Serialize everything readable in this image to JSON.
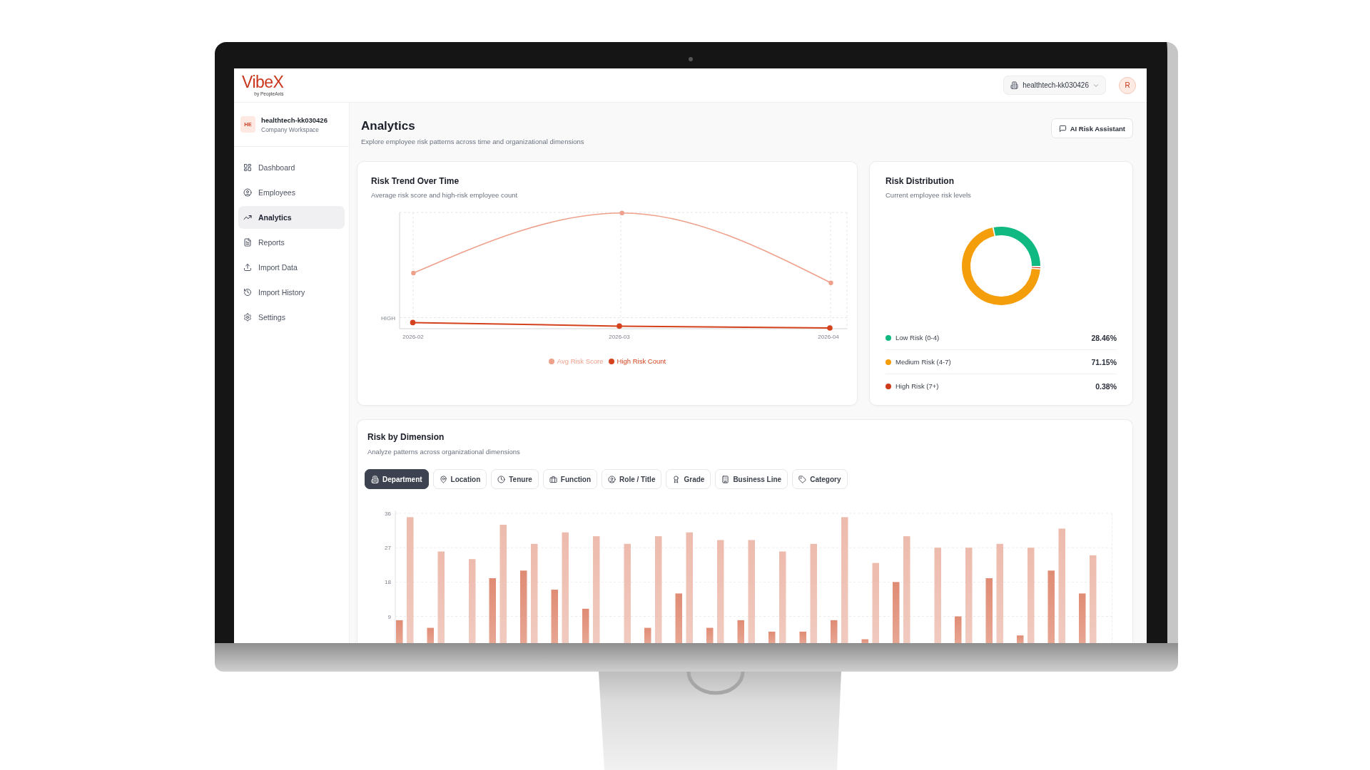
{
  "header": {
    "logo": "VibeX",
    "logo_tagline": "by PeopleAxis",
    "workspace_selector": "healthtech-kk030426",
    "avatar": "R"
  },
  "sidebar": {
    "workspace": {
      "initials": "HE",
      "name": "healthtech-kk030426",
      "label": "Company Workspace"
    },
    "items": [
      {
        "label": "Dashboard",
        "selected": false
      },
      {
        "label": "Employees",
        "selected": false
      },
      {
        "label": "Analytics",
        "selected": true
      },
      {
        "label": "Reports",
        "selected": false
      },
      {
        "label": "Import Data",
        "selected": false
      },
      {
        "label": "Import History",
        "selected": false
      },
      {
        "label": "Settings",
        "selected": false
      }
    ]
  },
  "page": {
    "title": "Analytics",
    "subtitle": "Explore employee risk patterns across time and organizational dimensions",
    "assistant_button": "AI Risk Assistant"
  },
  "risk_trend": {
    "title": "Risk Trend Over Time",
    "subtitle": "Average risk score and high-risk employee count",
    "y_axis_label": "HIGH",
    "x_labels": [
      "2026-02",
      "2026-03",
      "2026-04"
    ],
    "legend": [
      {
        "label": "Avg Risk Score",
        "color": "#eea08a"
      },
      {
        "label": "High Risk Count",
        "color": "#d4421e"
      }
    ]
  },
  "risk_distribution": {
    "title": "Risk Distribution",
    "subtitle": "Current employee risk levels",
    "chart_data": {
      "type": "donut",
      "values": [
        28.46,
        71.15,
        0.38
      ]
    },
    "legend": [
      {
        "label": "Low Risk (0-4)",
        "value": "28.46%",
        "color": "#10b981"
      },
      {
        "label": "Medium Risk (4-7)",
        "value": "71.15%",
        "color": "#f59e0b"
      },
      {
        "label": "High Risk (7+)",
        "value": "0.38%",
        "color": "#cf3b1b"
      }
    ]
  },
  "risk_by_dimension": {
    "title": "Risk by Dimension",
    "subtitle": "Analyze patterns across organizational dimensions",
    "tabs": [
      {
        "label": "Department",
        "selected": true
      },
      {
        "label": "Location",
        "selected": false
      },
      {
        "label": "Tenure",
        "selected": false
      },
      {
        "label": "Function",
        "selected": false
      },
      {
        "label": "Role / Title",
        "selected": false
      },
      {
        "label": "Grade",
        "selected": false
      },
      {
        "label": "Business Line",
        "selected": false
      },
      {
        "label": "Category",
        "selected": false
      }
    ],
    "chart_data": {
      "type": "bar",
      "grid": true,
      "ylim": [
        2,
        36
      ],
      "yticks": [
        9,
        18,
        27,
        36
      ],
      "series": [
        {
          "color": "#e08c74",
          "values": [
            8,
            6,
            null,
            19,
            21,
            16,
            11,
            null,
            6,
            15,
            6,
            8,
            5,
            5,
            8,
            3,
            18,
            null,
            9,
            19,
            4,
            21,
            15
          ]
        },
        {
          "color": "#edbbad",
          "values": [
            35,
            26,
            24,
            33,
            28,
            31,
            30,
            28,
            30,
            31,
            29,
            29,
            26,
            28,
            35,
            23,
            30,
            27,
            27,
            28,
            27,
            32,
            25
          ]
        }
      ]
    }
  }
}
